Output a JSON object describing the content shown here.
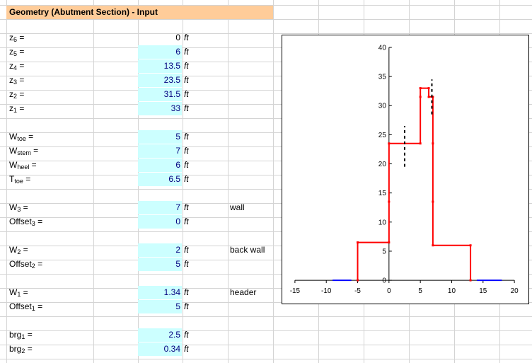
{
  "sheet": {
    "title": "Geometry (Abutment Section) - Input",
    "unit": "ft",
    "rows": [
      {
        "base": "z",
        "sub": "6",
        "eq": " =",
        "value": "0",
        "cyan": false,
        "note": ""
      },
      {
        "base": "z",
        "sub": "5",
        "eq": " =",
        "value": "6",
        "cyan": true,
        "note": ""
      },
      {
        "base": "z",
        "sub": "4",
        "eq": " =",
        "value": "13.5",
        "cyan": true,
        "note": ""
      },
      {
        "base": "z",
        "sub": "3",
        "eq": " =",
        "value": "23.5",
        "cyan": true,
        "note": ""
      },
      {
        "base": "z",
        "sub": "2",
        "eq": " =",
        "value": "31.5",
        "cyan": true,
        "note": ""
      },
      {
        "base": "z",
        "sub": "1",
        "eq": " =",
        "value": "33",
        "cyan": true,
        "note": ""
      },
      {
        "base": "W",
        "sub": "toe",
        "eq": " =",
        "value": "5",
        "cyan": true,
        "note": ""
      },
      {
        "base": "W",
        "sub": "stem",
        "eq": " =",
        "value": "7",
        "cyan": true,
        "note": ""
      },
      {
        "base": "W",
        "sub": "heel",
        "eq": " =",
        "value": "6",
        "cyan": true,
        "note": ""
      },
      {
        "base": "T",
        "sub": "toe",
        "eq": " =",
        "value": "6.5",
        "cyan": true,
        "note": ""
      },
      {
        "base": "W",
        "sub": "3",
        "eq": " =",
        "value": "7",
        "cyan": true,
        "note": "wall"
      },
      {
        "base": "Offset",
        "sub": "3",
        "eq": " =",
        "value": "0",
        "cyan": true,
        "note": ""
      },
      {
        "base": "W",
        "sub": "2",
        "eq": " =",
        "value": "2",
        "cyan": true,
        "note": "back wall"
      },
      {
        "base": "Offset",
        "sub": "2",
        "eq": " =",
        "value": "5",
        "cyan": true,
        "note": ""
      },
      {
        "base": "W",
        "sub": "1",
        "eq": " =",
        "value": "1.34",
        "cyan": true,
        "note": "header"
      },
      {
        "base": "Offset",
        "sub": "1",
        "eq": " =",
        "value": "5",
        "cyan": true,
        "note": ""
      },
      {
        "base": "brg",
        "sub": "1",
        "eq": " =",
        "value": "2.5",
        "cyan": true,
        "note": ""
      },
      {
        "base": "brg",
        "sub": "2",
        "eq": " =",
        "value": "0.34",
        "cyan": true,
        "note": ""
      }
    ]
  },
  "chart_data": {
    "type": "line",
    "xlim": [
      -15,
      20
    ],
    "ylim": [
      0,
      40
    ],
    "x_ticks": [
      -15,
      -10,
      -5,
      0,
      5,
      10,
      15,
      20
    ],
    "y_ticks": [
      0,
      5,
      10,
      15,
      20,
      25,
      30,
      35,
      40
    ],
    "grid": false,
    "series": [
      {
        "color": "#ff0000",
        "style": "solid-with-markers",
        "points": [
          [
            -5,
            0
          ],
          [
            -5,
            6.5
          ],
          [
            0,
            6.5
          ],
          [
            0,
            13.5
          ],
          [
            0,
            23.5
          ],
          [
            5,
            23.5
          ],
          [
            5,
            31.5
          ],
          [
            5,
            33
          ],
          [
            6.34,
            33
          ],
          [
            6.34,
            31.5
          ],
          [
            7,
            31.5
          ],
          [
            7,
            23.5
          ],
          [
            7,
            13.5
          ],
          [
            7,
            6
          ],
          [
            13,
            6
          ],
          [
            13,
            0
          ]
        ]
      },
      {
        "color": "#0000ff",
        "style": "solid",
        "points": [
          [
            -9,
            0
          ],
          [
            -6,
            0
          ]
        ]
      },
      {
        "color": "#0000ff",
        "style": "solid",
        "points": [
          [
            14,
            0
          ],
          [
            18,
            0
          ]
        ]
      },
      {
        "color": "#000000",
        "style": "dashed",
        "points": [
          [
            2.5,
            19.5
          ],
          [
            2.5,
            26.5
          ]
        ]
      },
      {
        "color": "#000000",
        "style": "dashed",
        "points": [
          [
            6.84,
            28.5
          ],
          [
            6.84,
            34.5
          ]
        ]
      }
    ]
  }
}
